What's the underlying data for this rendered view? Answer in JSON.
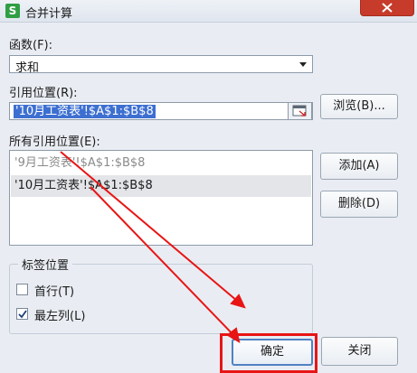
{
  "window": {
    "title": "合并计算",
    "app_icon_glyph": "S"
  },
  "function": {
    "label": "函数(F):",
    "value": "求和"
  },
  "reference": {
    "label": "引用位置(R):",
    "value": "'10月工资表'!$A$1:$B$8"
  },
  "all_refs": {
    "label": "所有引用位置(E):",
    "items": [
      "'9月工资表'!$A$1:$B$8",
      "'10月工资表'!$A$1:$B$8"
    ]
  },
  "buttons": {
    "browse": "浏览(B)...",
    "add": "添加(A)",
    "delete": "删除(D)",
    "ok": "确定",
    "close": "关闭"
  },
  "labels_group": {
    "title": "标签位置",
    "first_row": {
      "label": "首行(T)",
      "checked": false
    },
    "left_column": {
      "label": "最左列(L)",
      "checked": true
    }
  },
  "colors": {
    "highlight": "#e81515",
    "selection": "#3d6fd1",
    "titlebar_close": "#c73b2a"
  }
}
